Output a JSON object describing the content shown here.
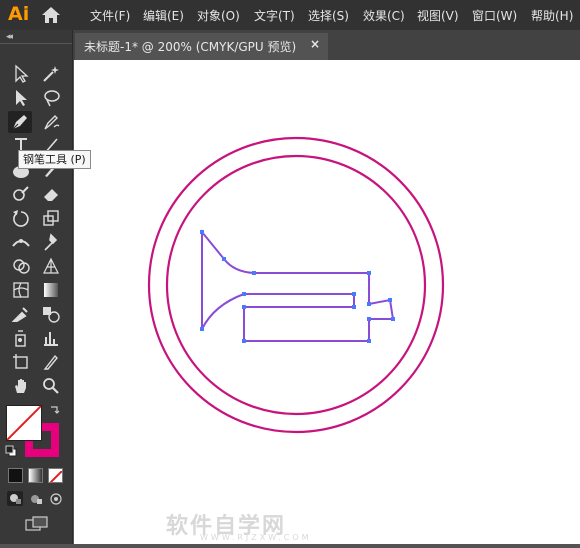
{
  "app": {
    "logo": "Ai",
    "home_icon": "home-icon"
  },
  "menu": [
    "文件(F)",
    "编辑(E)",
    "对象(O)",
    "文字(T)",
    "选择(S)",
    "效果(C)",
    "视图(V)",
    "窗口(W)",
    "帮助(H)"
  ],
  "document_tab": {
    "title": "未标题-1* @ 200% (CMYK/GPU 预览)",
    "close": "×"
  },
  "toolbar": {
    "collapse": "◂◂",
    "active_tool": "pen-tool",
    "tools": [
      "selection-tool",
      "magic-wand-tool",
      "direct-selection-tool",
      "lasso-tool",
      "pen-tool",
      "curvature-tool",
      "type-tool",
      "line-segment-tool",
      "ellipse-tool",
      "paintbrush-tool",
      "shaper-tool",
      "eraser-tool",
      "rotate-tool",
      "scale-tool",
      "width-tool",
      "puppet-warp-tool",
      "shape-builder-tool",
      "perspective-grid-tool",
      "mesh-tool",
      "gradient-tool",
      "eyedropper-tool",
      "symbol-sprayer-tool",
      "blend-tool",
      "column-graph-tool",
      "artboard-tool",
      "slice-tool",
      "hand-tool",
      "zoom-tool"
    ]
  },
  "tooltip": "钢笔工具 (P)",
  "colors": {
    "fill": "#ffffff",
    "stroke": "#e6007e",
    "path": "#8a4bd6",
    "circle": "#c7137e",
    "anchor": "#4a78ff"
  },
  "watermark": {
    "main": "软件自学网",
    "sub": "WWW.RJZXW.COM"
  }
}
